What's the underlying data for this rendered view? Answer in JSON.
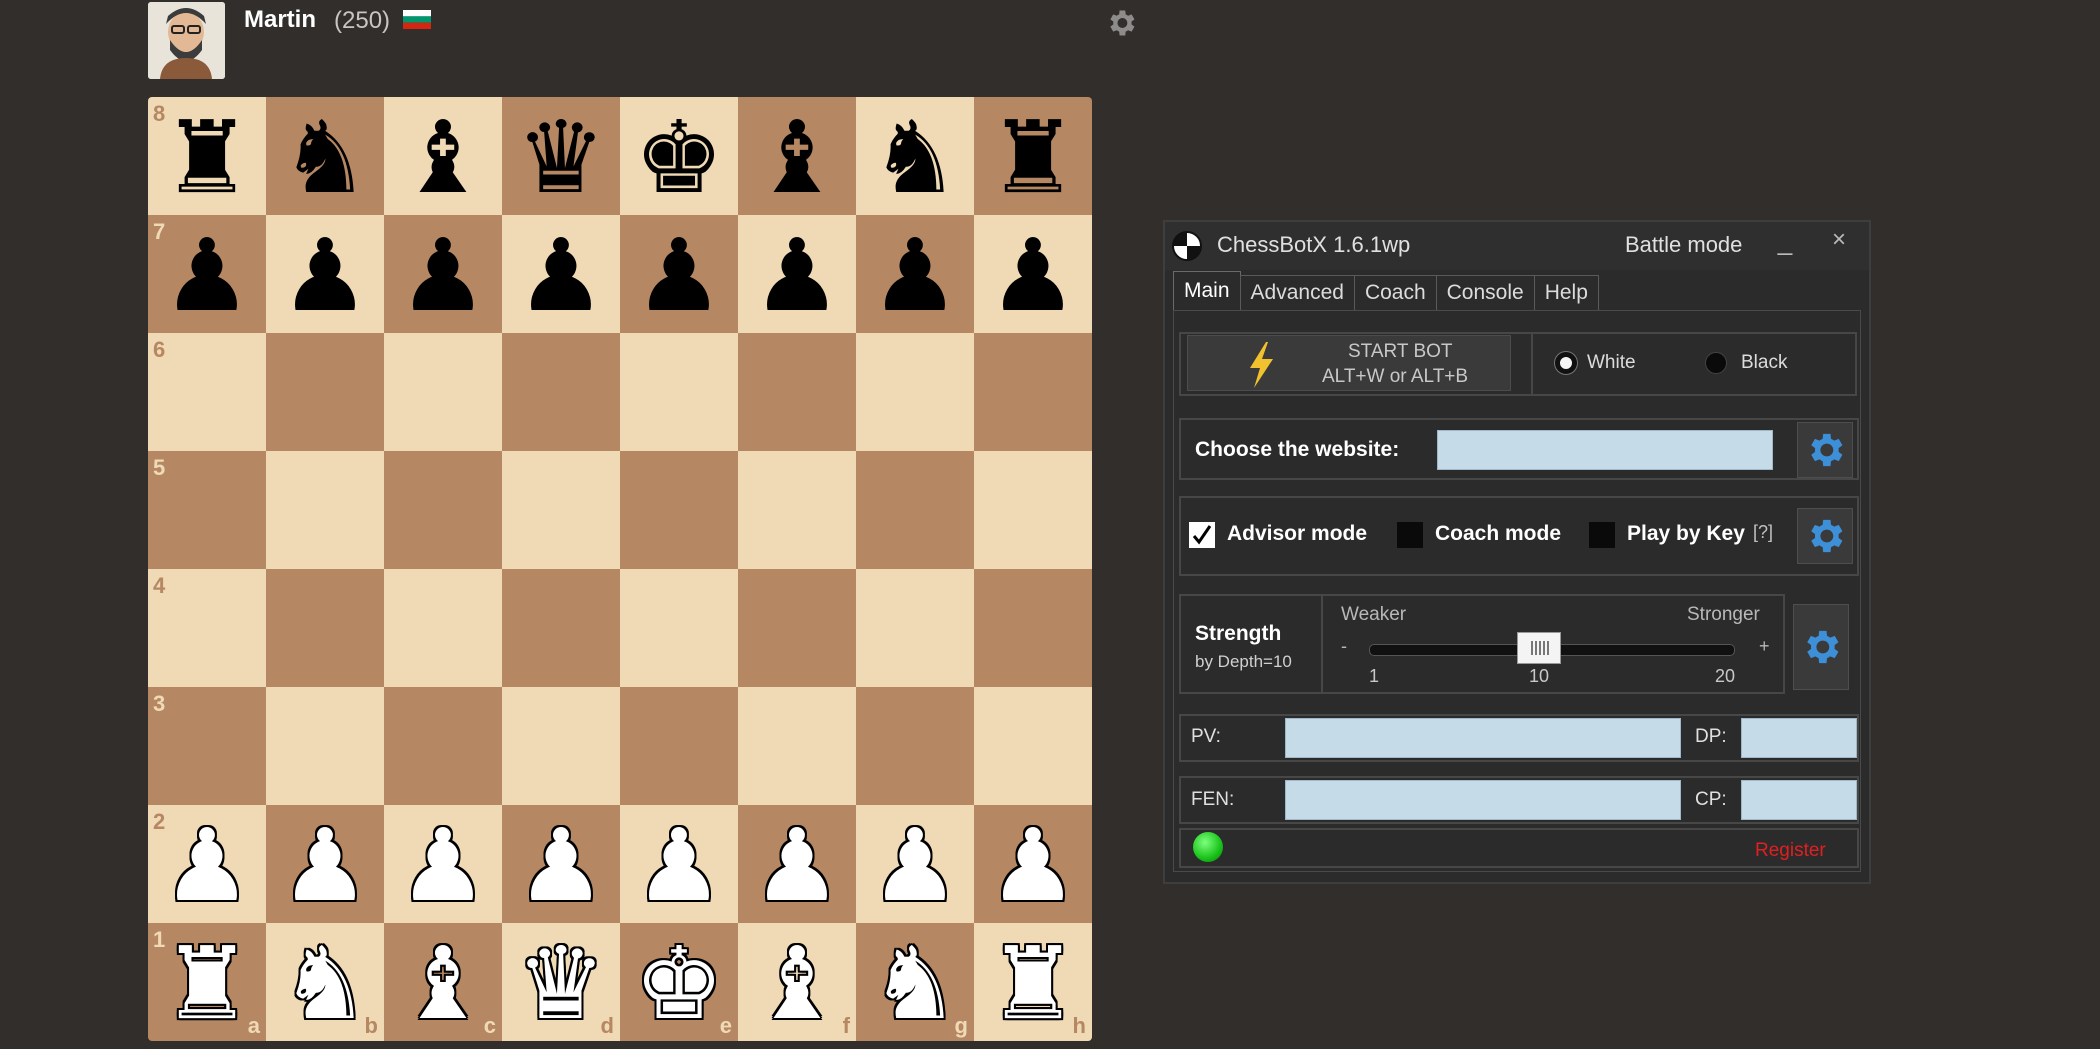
{
  "player": {
    "name": "Martin",
    "rating": "(250)",
    "flag_colors": [
      "#ffffff",
      "#00966e",
      "#d62612"
    ]
  },
  "board": {
    "light_color": "#f0d9b5",
    "dark_color": "#b58863",
    "ranks": [
      "8",
      "7",
      "6",
      "5",
      "4",
      "3",
      "2",
      "1"
    ],
    "files": [
      "a",
      "b",
      "c",
      "d",
      "e",
      "f",
      "g",
      "h"
    ],
    "position": [
      [
        "r",
        "n",
        "b",
        "q",
        "k",
        "b",
        "n",
        "r"
      ],
      [
        "p",
        "p",
        "p",
        "p",
        "p",
        "p",
        "p",
        "p"
      ],
      [
        "",
        "",
        "",
        "",
        "",
        "",
        "",
        ""
      ],
      [
        "",
        "",
        "",
        "",
        "",
        "",
        "",
        ""
      ],
      [
        "",
        "",
        "",
        "",
        "",
        "",
        "",
        ""
      ],
      [
        "",
        "",
        "",
        "",
        "",
        "",
        "",
        ""
      ],
      [
        "P",
        "P",
        "P",
        "P",
        "P",
        "P",
        "P",
        "P"
      ],
      [
        "R",
        "N",
        "B",
        "Q",
        "K",
        "B",
        "N",
        "R"
      ]
    ]
  },
  "bot": {
    "title": "ChessBotX 1.6.1wp",
    "mode": "Battle mode",
    "minimize": "_",
    "close": "×",
    "tabs": [
      "Main",
      "Advanced",
      "Coach",
      "Console",
      "Help"
    ],
    "active_tab": "Main",
    "start_bot": {
      "line1": "START BOT",
      "line2": "ALT+W or ALT+B"
    },
    "side": {
      "white": "White",
      "black": "Black",
      "selected": "White"
    },
    "website": {
      "label": "Choose the website:",
      "value": ""
    },
    "options": {
      "advisor": {
        "label": "Advisor mode",
        "checked": true
      },
      "coach": {
        "label": "Coach mode",
        "checked": false
      },
      "play_by_key": {
        "label": "Play by Key",
        "checked": false,
        "help": "[?]"
      }
    },
    "strength": {
      "label": "Strength",
      "depth_label": "by Depth=10",
      "weaker": "Weaker",
      "stronger": "Stronger",
      "minus": "-",
      "plus": "+",
      "min": "1",
      "mid": "10",
      "max": "20",
      "value": 10
    },
    "fields": {
      "pv": {
        "label": "PV:",
        "value": ""
      },
      "dp": {
        "label": "DP:",
        "value": ""
      },
      "fen": {
        "label": "FEN:",
        "value": ""
      },
      "cp": {
        "label": "CP:",
        "value": ""
      }
    },
    "status_color": "#19c219",
    "register": "Register"
  },
  "icons": {
    "settings": "gear-icon",
    "bot_logo": "chessboard-icon",
    "start_bot": "lightning-icon"
  }
}
